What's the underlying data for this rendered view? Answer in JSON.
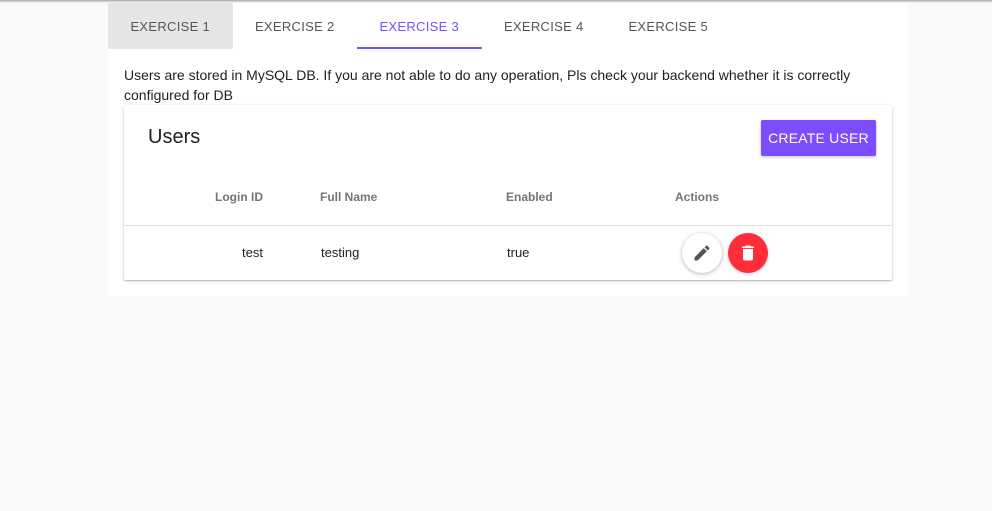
{
  "tabs": [
    {
      "label": "Exercise 1",
      "state": "hover"
    },
    {
      "label": "Exercise 2",
      "state": "normal"
    },
    {
      "label": "Exercise 3",
      "state": "active"
    },
    {
      "label": "Exercise 4",
      "state": "normal"
    },
    {
      "label": "Exercise 5",
      "state": "normal"
    }
  ],
  "notice": "Users are stored in MySQL DB. If you are not able to do any operation, Pls check your backend whether it is correctly configured for DB",
  "users_card": {
    "title": "Users",
    "create_button_label": "Create User",
    "columns": {
      "login_id": "Login ID",
      "full_name": "Full Name",
      "enabled": "Enabled",
      "actions": "Actions"
    },
    "rows": [
      {
        "login_id": "test",
        "full_name": "testing",
        "enabled": "true"
      }
    ],
    "icons": {
      "edit": "pencil-icon",
      "delete": "trash-icon"
    }
  },
  "colors": {
    "accent": "#7c4dff",
    "danger": "#ff2d3a",
    "background": "#fafafa"
  }
}
